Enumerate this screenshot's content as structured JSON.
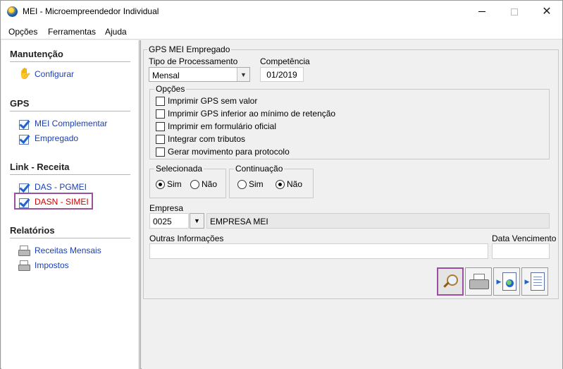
{
  "window": {
    "title": "MEI - Microempreendedor Individual"
  },
  "menu": {
    "items": [
      "Opções",
      "Ferramentas",
      "Ajuda"
    ]
  },
  "sidebar": {
    "sections": [
      {
        "title": "Manutenção",
        "items": [
          {
            "label": "Configurar",
            "icon": "gear-hand-icon"
          }
        ]
      },
      {
        "title": "GPS",
        "items": [
          {
            "label": "MEI Complementar",
            "icon": "check-icon"
          },
          {
            "label": "Empregado",
            "icon": "check-icon"
          }
        ]
      },
      {
        "title": "Link - Receita",
        "items": [
          {
            "label": "DAS - PGMEI",
            "icon": "check-icon"
          },
          {
            "label": "DASN - SIMEI",
            "icon": "check-icon",
            "highlighted": true
          }
        ]
      },
      {
        "title": "Relatórios",
        "items": [
          {
            "label": "Receitas Mensais",
            "icon": "printer-icon"
          },
          {
            "label": "Impostos",
            "icon": "printer-icon"
          }
        ]
      }
    ]
  },
  "form": {
    "group_title": "GPS MEI Empregado",
    "tipo_label": "Tipo de Processamento",
    "tipo_value": "Mensal",
    "competencia_label": "Competência",
    "competencia_value": "01/2019",
    "opcoes_title": "Opções",
    "opcoes": [
      {
        "label": "Imprimir GPS sem valor",
        "checked": false
      },
      {
        "label": "Imprimir GPS inferior ao mínimo de retenção",
        "checked": false
      },
      {
        "label": "Imprimir em formulário oficial",
        "checked": false
      },
      {
        "label": "Integrar com tributos",
        "checked": false
      },
      {
        "label": "Gerar movimento para protocolo",
        "checked": false
      }
    ],
    "selecionada": {
      "title": "Selecionada",
      "sim": "Sim",
      "nao": "Não",
      "selected": "Sim"
    },
    "continuacao": {
      "title": "Continuação",
      "sim": "Sim",
      "nao": "Não",
      "selected": "Não"
    },
    "empresa_label": "Empresa",
    "empresa_code": "0025",
    "empresa_name": "EMPRESA MEI",
    "outras_label": "Outras Informações",
    "outras_value": "",
    "vencimento_label": "Data Vencimento",
    "vencimento_value": ""
  },
  "toolbar": {
    "buttons": [
      {
        "icon": "magnifier-preview-icon",
        "active": true
      },
      {
        "icon": "printer-icon",
        "active": false
      },
      {
        "icon": "export-web-document-icon",
        "active": false
      },
      {
        "icon": "export-text-document-icon",
        "active": false
      }
    ]
  }
}
